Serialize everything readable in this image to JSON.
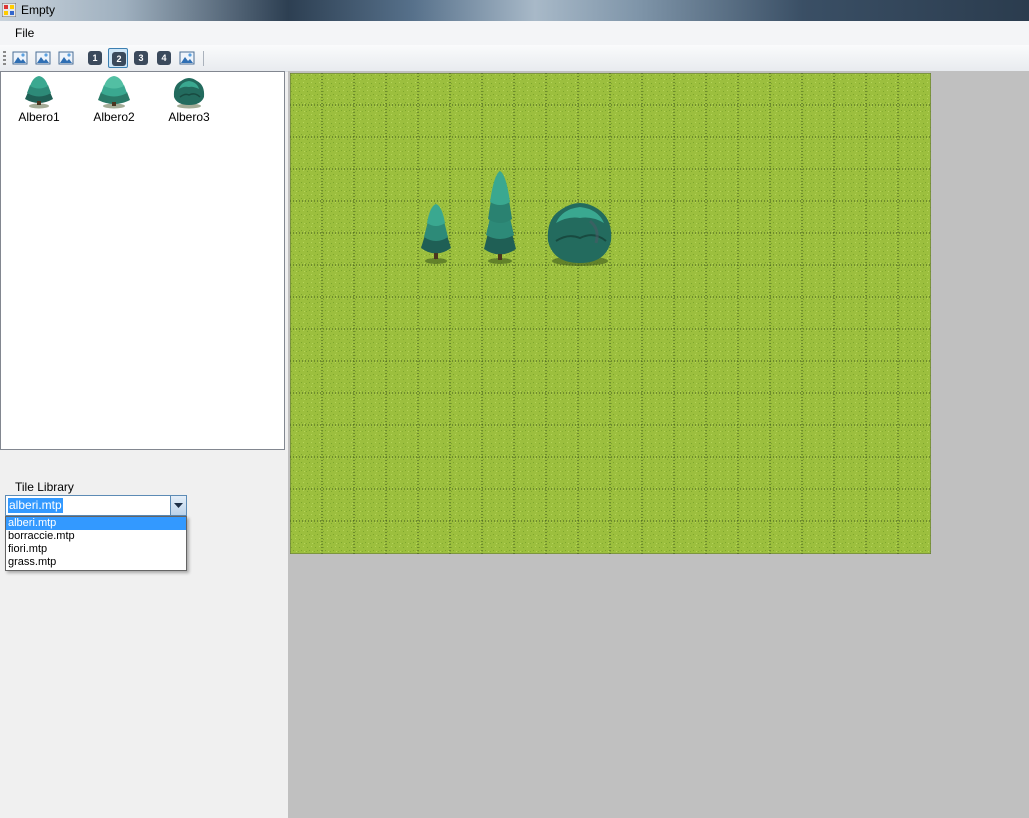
{
  "window": {
    "title": "Empty"
  },
  "menu": {
    "file_label": "File"
  },
  "toolbar": {
    "buttons": [
      {
        "icon": "image-icon"
      },
      {
        "icon": "image-icon"
      },
      {
        "icon": "image-icon"
      },
      {
        "label": "1"
      },
      {
        "label": "2",
        "pressed": true
      },
      {
        "label": "3"
      },
      {
        "label": "4"
      },
      {
        "icon": "image-icon"
      }
    ]
  },
  "tiles": [
    {
      "label": "Albero1"
    },
    {
      "label": "Albero2"
    },
    {
      "label": "Albero3"
    }
  ],
  "tile_library": {
    "label": "Tile Library",
    "selected": "alberi.mtp",
    "options": [
      "alberi.mtp",
      "borraccie.mtp",
      "fiori.mtp",
      "grass.mtp"
    ]
  },
  "map": {
    "grid_columns": 20,
    "grid_rows": 15,
    "grass_color": "#9cbf3e",
    "grid_line_color": "#3f5a1c"
  },
  "colors": {
    "selection": "#3399ff",
    "tree_dark": "#1f5f55",
    "tree_light": "#3aa890",
    "map_background": "#c0c0c0"
  }
}
